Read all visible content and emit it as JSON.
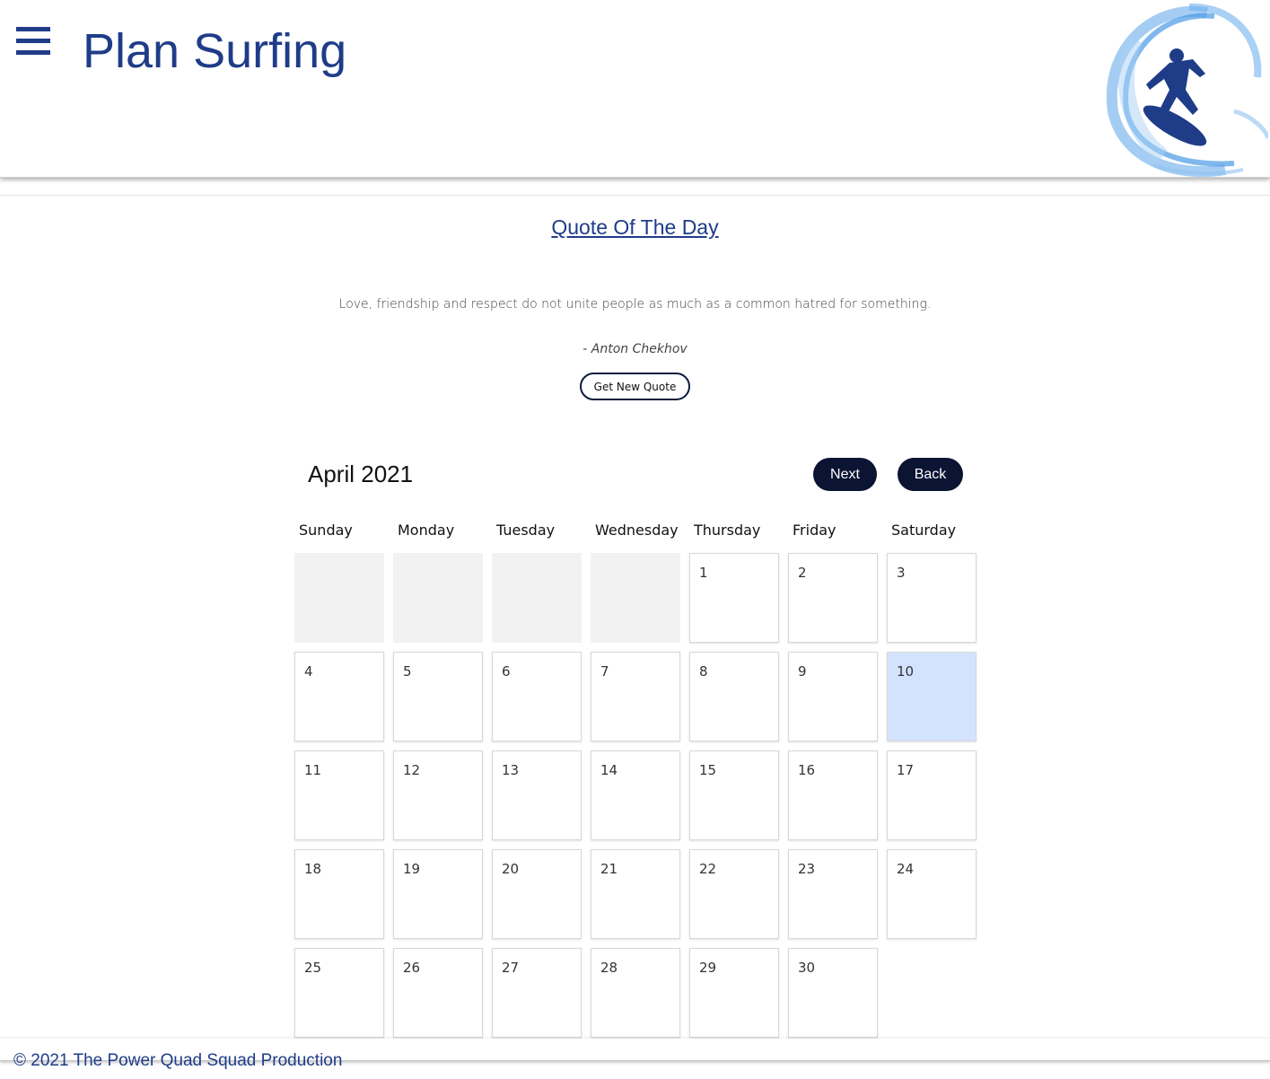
{
  "header": {
    "title": "Plan Surfing",
    "menu_icon": "hamburger-icon",
    "logo_icon": "surfer-wave-logo"
  },
  "quote": {
    "heading": "Quote Of The Day",
    "text": "Love, friendship and respect do not unite people as much as a common hatred for something.",
    "author": "- Anton Chekhov",
    "button_label": "Get New Quote"
  },
  "calendar": {
    "month_label": "April 2021",
    "next_label": "Next",
    "back_label": "Back",
    "weekdays": [
      "Sunday",
      "Monday",
      "Tuesday",
      "Wednesday",
      "Thursday",
      "Friday",
      "Saturday"
    ],
    "leading_empty_days": 4,
    "days_in_month": 30,
    "highlighted_day": 10,
    "highlight_color": "#d2e2ff",
    "days": [
      "1",
      "2",
      "3",
      "4",
      "5",
      "6",
      "7",
      "8",
      "9",
      "10",
      "11",
      "12",
      "13",
      "14",
      "15",
      "16",
      "17",
      "18",
      "19",
      "20",
      "21",
      "22",
      "23",
      "24",
      "25",
      "26",
      "27",
      "28",
      "29",
      "30"
    ]
  },
  "footer": {
    "text": "© 2021 The Power Quad Squad Production"
  },
  "colors": {
    "brand": "#1f3c88",
    "button_dark": "#0b1433"
  }
}
